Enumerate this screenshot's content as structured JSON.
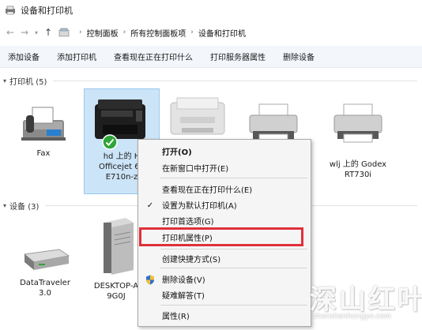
{
  "window": {
    "title": "设备和打印机"
  },
  "address": {
    "crumbs": [
      "控制面板",
      "所有控制面板项",
      "设备和打印机"
    ]
  },
  "toolbar": {
    "buttons": [
      "添加设备",
      "添加打印机",
      "查看现在正在打印什么",
      "打印服务器属性",
      "删除设备"
    ]
  },
  "groups": {
    "printers": "打印机 (5)",
    "devices": "设备 (3)"
  },
  "printers": [
    {
      "lines": [
        "Fax"
      ]
    },
    {
      "lines": [
        "hd 上的 H",
        "Officejet 65",
        "E710n-z"
      ]
    },
    {
      "lines": [
        ""
      ]
    },
    {
      "lines": [
        ""
      ]
    },
    {
      "lines": [
        "wlj 上的 Godex",
        "RT730i"
      ]
    }
  ],
  "devices": [
    {
      "lines": [
        "DataTraveler",
        "3.0"
      ]
    },
    {
      "lines": [
        "DESKTOP-A",
        "9G0J"
      ]
    }
  ],
  "context_menu": {
    "items": [
      "打开(O)",
      "在新窗口中打开(E)",
      "查看现在正在打印什么(E)",
      "设置为默认打印机(A)",
      "打印首选项(G)",
      "打印机属性(P)",
      "创建快捷方式(S)",
      "删除设备(V)",
      "疑难解答(T)",
      "属性(R)"
    ]
  },
  "watermark": {
    "big": "深山红叶",
    "small": "shenshanhongye.com"
  },
  "colors": {
    "selection": "#cce4f7",
    "highlight": "#e0303a",
    "toolbar": "#f3f6fb"
  }
}
